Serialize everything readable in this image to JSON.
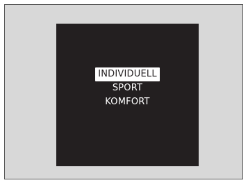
{
  "drive_mode_menu": {
    "items": [
      {
        "label": "INDIVIDUELL",
        "selected": true
      },
      {
        "label": "SPORT",
        "selected": false
      },
      {
        "label": "KOMFORT",
        "selected": false
      }
    ]
  },
  "colors": {
    "frame_background": "#d8d8d8",
    "frame_border": "#555555",
    "screen_background": "#231f20",
    "text": "#ffffff",
    "highlight": "#ffffff"
  }
}
